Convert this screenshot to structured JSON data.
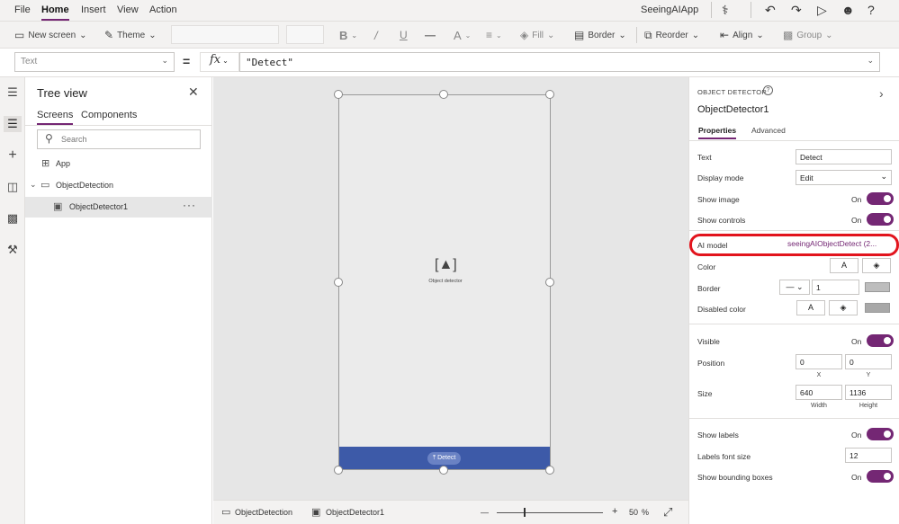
{
  "menubar": {
    "items": [
      "File",
      "Home",
      "Insert",
      "View",
      "Action"
    ],
    "app_title": "SeeingAIApp"
  },
  "ribbon": {
    "new_screen": "New screen",
    "theme": "Theme",
    "fill": "Fill",
    "border": "Border",
    "reorder": "Reorder",
    "align": "Align",
    "group": "Group"
  },
  "formula_bar": {
    "property": "Text",
    "fx": "fx",
    "formula": "\"Detect\""
  },
  "tree": {
    "title": "Tree view",
    "tabs": [
      "Screens",
      "Components"
    ],
    "search_placeholder": "Search",
    "items": [
      "App",
      "ObjectDetection",
      "ObjectDetector1"
    ]
  },
  "canvas": {
    "object_label": "Object detector",
    "button_label": "Detect"
  },
  "status": {
    "screen": "ObjectDetection",
    "control": "ObjectDetector1",
    "zoom_minus": "—",
    "zoom_plus": "+",
    "zoom_value": "50",
    "zoom_unit": "%",
    "zoom_fraction": 0.5
  },
  "props": {
    "type_label": "OBJECT DETECTOR",
    "name": "ObjectDetector1",
    "tabs": [
      "Properties",
      "Advanced"
    ],
    "text_label": "Text",
    "text_value": "Detect",
    "display_mode_label": "Display mode",
    "display_mode_value": "Edit",
    "show_image_label": "Show image",
    "show_image_value": "On",
    "show_controls_label": "Show controls",
    "show_controls_value": "On",
    "ai_model_label": "AI model",
    "ai_model_value": "seeingAIObjectDetect (2...",
    "color_label": "Color",
    "color_a": "A",
    "border_label": "Border",
    "border_width": "1",
    "disabled_color_label": "Disabled color",
    "visible_label": "Visible",
    "visible_value": "On",
    "position_label": "Position",
    "pos_x": "0",
    "pos_y": "0",
    "x_label": "X",
    "y_label": "Y",
    "size_label": "Size",
    "width": "640",
    "height": "1136",
    "width_label": "Width",
    "height_label": "Height",
    "show_labels_label": "Show labels",
    "show_labels_value": "On",
    "labels_font_size_label": "Labels font size",
    "labels_font_size_value": "12",
    "show_bounding_label": "Show bounding boxes",
    "show_bounding_value": "On",
    "highlight_color": "#e2141d",
    "accent_color": "#742774"
  }
}
